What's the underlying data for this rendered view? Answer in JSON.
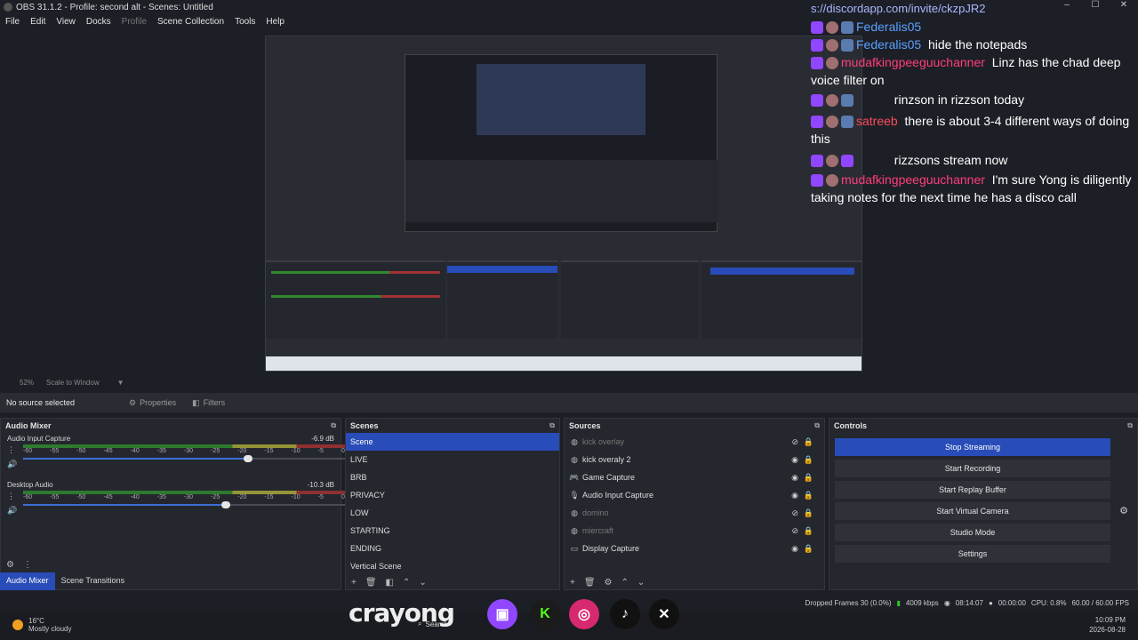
{
  "window": {
    "title": "OBS 31.1.2 - Profile: second alt - Scenes: Untitled",
    "controls": [
      "–",
      "☐",
      "✕"
    ]
  },
  "menu": [
    "File",
    "Edit",
    "View",
    "Docks",
    "Profile",
    "Scene Collection",
    "Tools",
    "Help"
  ],
  "chat": {
    "link": "s://discordapp.com/invite/ckzpJR2",
    "messages": [
      {
        "user": "Federalis05",
        "user_color": "blue",
        "text": ""
      },
      {
        "user": "Federalis05",
        "user_color": "blue",
        "text": "hide the notepads"
      },
      {
        "user": "mudafkingpeeguuchanner",
        "user_color": "pink",
        "text": "Linz has the chad deep voice filter on"
      },
      {
        "user": "",
        "user_color": "dark",
        "text": "rinzson in rizzson today"
      },
      {
        "user": "satreeb",
        "user_color": "red",
        "text": "there is about 3-4 different ways of doing this"
      },
      {
        "user": "",
        "user_color": "dark",
        "text": "rizzsons stream now"
      },
      {
        "user": "mudafkingpeeguuchanner",
        "user_color": "pink",
        "text": "I'm sure Yong is diligently taking notes for the next time he has a disco call"
      }
    ]
  },
  "preview": {
    "zoom": "52%",
    "scale_mode": "Scale to Window"
  },
  "properties_bar": {
    "no_source": "No source selected",
    "properties": "Properties",
    "filters": "Filters"
  },
  "audio_mixer": {
    "title": "Audio Mixer",
    "tracks": [
      {
        "name": "Audio Input Capture",
        "db": "-6.9 dB",
        "level": 0.7
      },
      {
        "name": "Desktop Audio",
        "db": "-10.3 dB",
        "level": 0.63
      }
    ],
    "ticks": [
      "-60",
      "-55",
      "-50",
      "-45",
      "-40",
      "-35",
      "-30",
      "-25",
      "-20",
      "-15",
      "-10",
      "-5",
      "0"
    ]
  },
  "scenes": {
    "title": "Scenes",
    "items": [
      "Scene",
      "LIVE",
      "BRB",
      "PRIVACY",
      "LOW",
      "STARTING",
      "ENDING",
      "Vertical Scene"
    ],
    "selected": 0
  },
  "sources": {
    "title": "Sources",
    "items": [
      {
        "name": "kick overlay",
        "visible": false
      },
      {
        "name": "kick overaly 2",
        "visible": true
      },
      {
        "name": "Game Capture",
        "visible": true
      },
      {
        "name": "Audio Input Capture",
        "visible": true
      },
      {
        "name": "domino",
        "visible": false
      },
      {
        "name": "miercraft",
        "visible": false
      },
      {
        "name": "Display Capture",
        "visible": true
      }
    ]
  },
  "controls": {
    "title": "Controls",
    "buttons": [
      "Stop Streaming",
      "Start Recording",
      "Start Replay Buffer",
      "Start Virtual Camera",
      "Studio Mode",
      "Settings"
    ]
  },
  "bottom_tabs": [
    "Audio Mixer",
    "Scene Transitions"
  ],
  "status": {
    "dropped": "Dropped Frames 30 (0.0%)",
    "bitrate": "4009 kbps",
    "live_time": "08:14:07",
    "rec_time": "00:00:00",
    "cpu": "CPU: 0.8%",
    "fps": "60.00 / 60.00 FPS"
  },
  "overlay": {
    "name": "crayong"
  },
  "taskbar": {
    "temp": "16°C",
    "weather": "Mostly cloudy",
    "search": "Search",
    "time": "10:09 PM",
    "date": "2026-08-28"
  },
  "colors": {
    "accent": "#284cb8",
    "twitch": "#9146ff",
    "kick": "#53fc18"
  }
}
